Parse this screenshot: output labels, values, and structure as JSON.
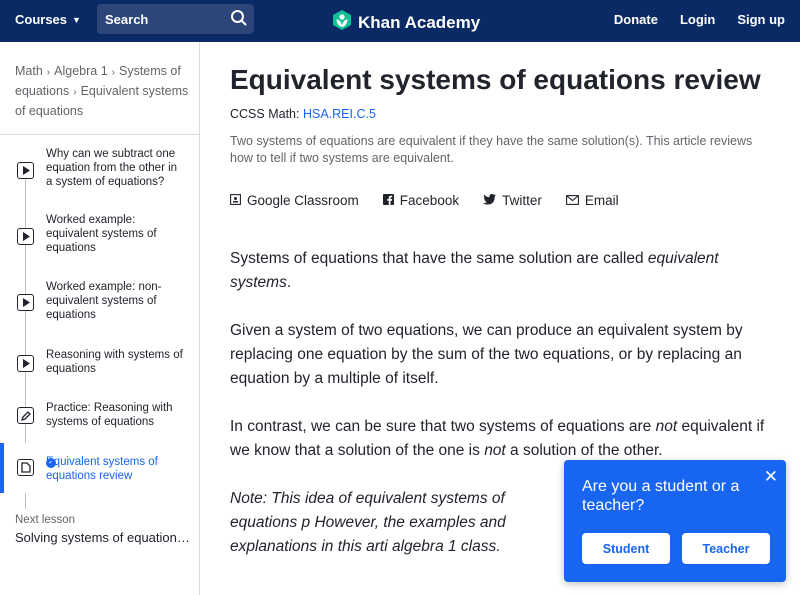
{
  "header": {
    "courses_label": "Courses",
    "search_label": "Search",
    "logo_text": "Khan Academy",
    "links": [
      "Donate",
      "Login",
      "Sign up"
    ]
  },
  "sidebar": {
    "breadcrumb": [
      "Math",
      "Algebra 1",
      "Systems of equations",
      "Equivalent systems of equations"
    ],
    "items": [
      {
        "label": "Why can we subtract one equation from the other in a system of equations?",
        "icon": "play-icon"
      },
      {
        "label": "Worked example: equivalent systems of equations",
        "icon": "play-icon"
      },
      {
        "label": "Worked example: non-equivalent systems of equations",
        "icon": "play-icon"
      },
      {
        "label": "Reasoning with systems of equations",
        "icon": "play-icon"
      },
      {
        "label": "Practice: Reasoning with systems of equations",
        "icon": "pencil-icon"
      },
      {
        "label": "Equivalent systems of equations review",
        "icon": "article-icon"
      }
    ],
    "next_label": "Next lesson",
    "next_title": "Solving systems of equations with substitution"
  },
  "article": {
    "title": "Equivalent systems of equations review",
    "ccss_label": "CCSS Math:",
    "ccss_code": "HSA.REI.C.5",
    "summary": "Two systems of equations are equivalent if they have the same solution(s). This article reviews how to tell if two systems are equivalent.",
    "share": [
      "Google Classroom",
      "Facebook",
      "Twitter",
      "Email"
    ],
    "p1_a": "Systems of equations that have the same solution are called ",
    "p1_em": "equivalent systems",
    "p1_b": ".",
    "p2": "Given a system of two equations, we can produce an equivalent system by replacing one equation by the sum of the two equations, or by replacing an equation by a multiple of itself.",
    "p3_a": "In contrast, we can be sure that two systems of equations are ",
    "p3_em1": "not",
    "p3_b": " equivalent if we know that a solution of the one is ",
    "p3_em2": "not",
    "p3_c": " a solution of the other.",
    "p4": "Note: This idea of equivalent systems of equations p However, the examples and explanations in this arti algebra 1 class."
  },
  "popup": {
    "question": "Are you a student or a teacher?",
    "student_label": "Student",
    "teacher_label": "Teacher",
    "close_symbol": "✕"
  },
  "colors": {
    "header_bg": "#0a2a66",
    "accent": "#1865f2",
    "text": "#21242c",
    "muted": "#626569"
  }
}
